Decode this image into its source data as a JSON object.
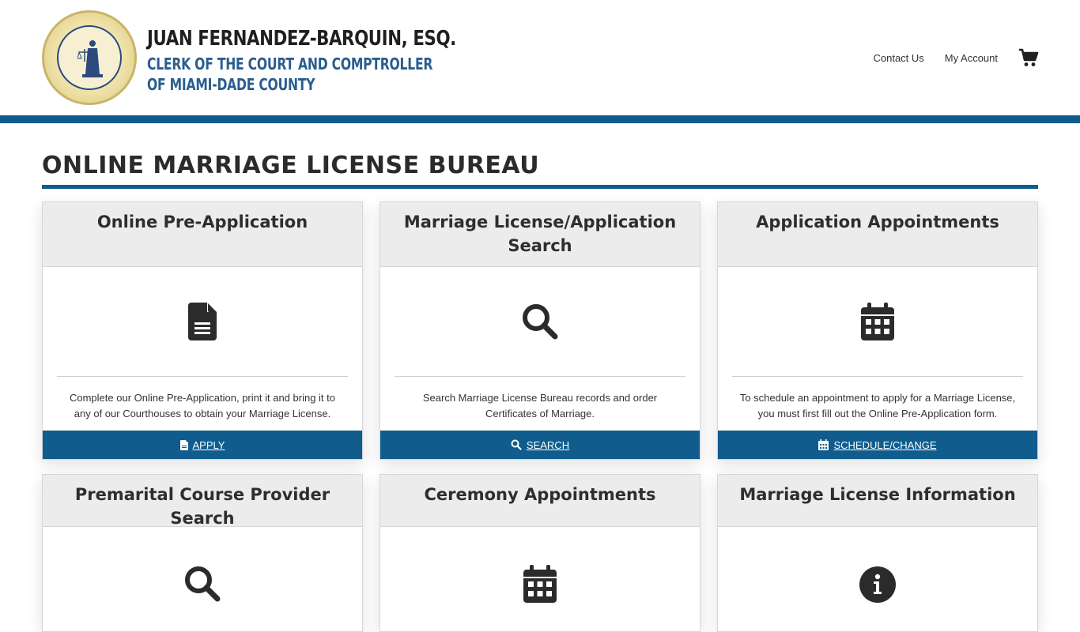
{
  "header": {
    "seal_alt": "JUAN FERNANDEZ-BARQUIN",
    "seal_ring_bottom": "IN GOD WE TRUST",
    "name": "JUAN FERNANDEZ-BARQUIN, ESQ.",
    "subtitle_line1": "CLERK OF THE COURT AND COMPTROLLER",
    "subtitle_line2": "OF MIAMI-DADE COUNTY",
    "nav": [
      {
        "label": "Contact Us"
      },
      {
        "label": "My Account"
      }
    ],
    "cart_icon": "cart-icon",
    "accent_color": "#0f5c8d"
  },
  "page": {
    "title": "ONLINE MARRIAGE LICENSE BUREAU"
  },
  "cards": [
    {
      "title": "Online Pre-Application",
      "icon": "document-icon",
      "description": "Complete our Online Pre-Application, print it and bring it to any of our Courthouses to obtain your Marriage License.",
      "button": "APPLY",
      "button_icon": "document-icon"
    },
    {
      "title": "Marriage License/Application Search",
      "icon": "search-icon",
      "description": "Search Marriage License Bureau records and order Certificates of Marriage.",
      "button": "SEARCH",
      "button_icon": "search-icon"
    },
    {
      "title": "Application Appointments",
      "icon": "calendar-icon",
      "description": "To schedule an appointment to apply for a Marriage License, you must first fill out the Online Pre-Application form.",
      "button": "SCHEDULE/CHANGE",
      "button_icon": "calendar-icon"
    },
    {
      "title": "Premarital Course Provider Search",
      "icon": "search-icon"
    },
    {
      "title": "Ceremony Appointments",
      "icon": "calendar-icon"
    },
    {
      "title": "Marriage License Information",
      "icon": "info-icon"
    }
  ]
}
